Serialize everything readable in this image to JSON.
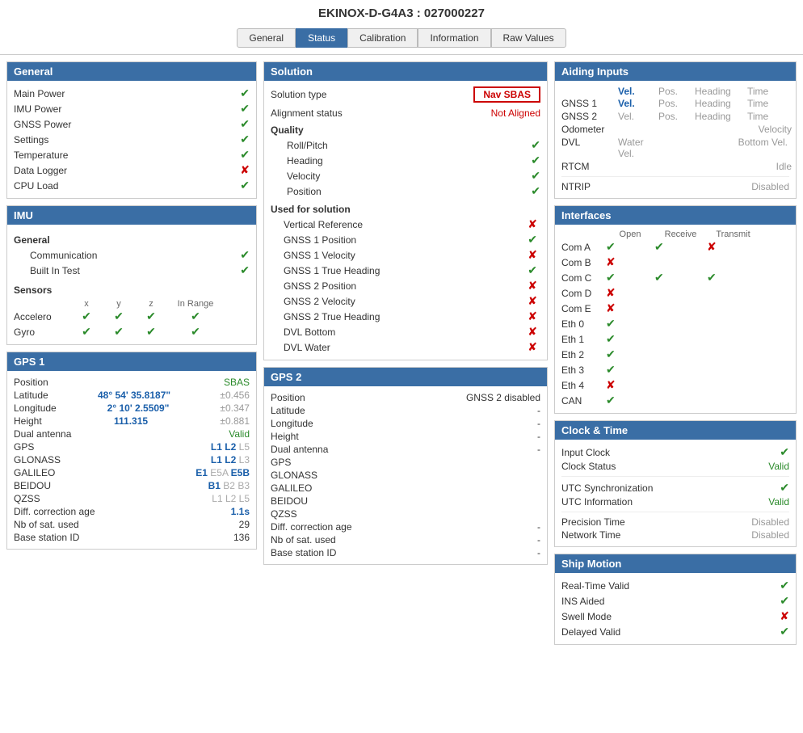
{
  "title": "EKINOX-D-G4A3 : 027000227",
  "tabs": [
    "General",
    "Status",
    "Calibration",
    "Information",
    "Raw Values"
  ],
  "active_tab": "Status",
  "general_panel": {
    "header": "General",
    "rows": [
      {
        "label": "Main Power",
        "status": "check"
      },
      {
        "label": "IMU Power",
        "status": "check"
      },
      {
        "label": "GNSS Power",
        "status": "check"
      },
      {
        "label": "Settings",
        "status": "check"
      },
      {
        "label": "Temperature",
        "status": "check"
      },
      {
        "label": "Data Logger",
        "status": "cross"
      },
      {
        "label": "CPU Load",
        "status": "check"
      }
    ]
  },
  "imu_panel": {
    "header": "IMU",
    "general_label": "General",
    "sub_rows": [
      {
        "label": "Communication",
        "status": "check"
      },
      {
        "label": "Built In Test",
        "status": "check"
      }
    ],
    "sensors_label": "Sensors",
    "sensor_headers": [
      "",
      "x",
      "y",
      "z",
      "In Range"
    ],
    "sensor_rows": [
      {
        "label": "Accelero",
        "x": "check",
        "y": "check",
        "z": "check",
        "range": "check"
      },
      {
        "label": "Gyro",
        "x": "check",
        "y": "check",
        "z": "check",
        "range": "check"
      }
    ]
  },
  "gps1_panel": {
    "header": "GPS 1",
    "position_label": "Position",
    "position_value": "SBAS",
    "latitude_label": "Latitude",
    "latitude_value": "48° 54' 35.8187\"",
    "latitude_err": "±0.456",
    "longitude_label": "Longitude",
    "longitude_value": "2° 10' 2.5509\"",
    "longitude_err": "±0.347",
    "height_label": "Height",
    "height_value": "111.315",
    "height_err": "±0.881",
    "dual_label": "Dual antenna",
    "dual_value": "Valid",
    "gps_label": "GPS",
    "gps_value": "L1 L2 L5",
    "glonass_label": "GLONASS",
    "glonass_value": "L1 L2 L3",
    "galileo_label": "GALILEO",
    "galileo_value": "E1 E5A E5B",
    "beidou_label": "BEIDOU",
    "beidou_value": "B1 B2 B3",
    "qzss_label": "QZSS",
    "qzss_value": "L1 L2 L5",
    "diff_label": "Diff. correction age",
    "diff_value": "1.1s",
    "nb_label": "Nb of sat. used",
    "nb_value": "29",
    "base_label": "Base station ID",
    "base_value": "136"
  },
  "solution_panel": {
    "header": "Solution",
    "sol_type_label": "Solution type",
    "sol_type_value": "Nav SBAS",
    "align_label": "Alignment status",
    "align_value": "Not Aligned",
    "quality_label": "Quality",
    "quality_rows": [
      {
        "label": "Roll/Pitch",
        "status": "check"
      },
      {
        "label": "Heading",
        "status": "check"
      },
      {
        "label": "Velocity",
        "status": "check"
      },
      {
        "label": "Position",
        "status": "check"
      }
    ],
    "used_label": "Used for solution",
    "used_rows": [
      {
        "label": "Vertical Reference",
        "status": "cross"
      },
      {
        "label": "GNSS 1 Position",
        "status": "check"
      },
      {
        "label": "GNSS 1 Velocity",
        "status": "cross"
      },
      {
        "label": "GNSS 1 True Heading",
        "status": "check"
      },
      {
        "label": "GNSS 2 Position",
        "status": "cross"
      },
      {
        "label": "GNSS 2 Velocity",
        "status": "cross"
      },
      {
        "label": "GNSS 2 True Heading",
        "status": "cross"
      },
      {
        "label": "DVL Bottom",
        "status": "cross"
      },
      {
        "label": "DVL Water",
        "status": "cross"
      }
    ]
  },
  "gps2_panel": {
    "header": "GPS 2",
    "position_label": "Position",
    "position_value": "GNSS 2 disabled",
    "latitude_label": "Latitude",
    "latitude_value": "-",
    "longitude_label": "Longitude",
    "longitude_value": "-",
    "height_label": "Height",
    "height_value": "-",
    "dual_label": "Dual antenna",
    "dual_value": "-",
    "gps_label": "GPS",
    "glonass_label": "GLONASS",
    "galileo_label": "GALILEO",
    "beidou_label": "BEIDOU",
    "qzss_label": "QZSS",
    "diff_label": "Diff. correction age",
    "diff_value": "-",
    "nb_label": "Nb of sat. used",
    "nb_value": "-",
    "base_label": "Base station ID",
    "base_value": "-"
  },
  "aiding_panel": {
    "header": "Aiding Inputs",
    "rows": [
      {
        "label": "GNSS 1",
        "vel": "Vel.",
        "pos": "Pos.",
        "heading": "Heading",
        "time": "Time",
        "vel_active": true,
        "pos_active": false,
        "heading_active": false,
        "time_active": false
      },
      {
        "label": "GNSS 2",
        "vel": "Vel.",
        "pos": "Pos.",
        "heading": "Heading",
        "time": "Time",
        "vel_active": false,
        "pos_active": false,
        "heading_active": false,
        "time_active": false
      },
      {
        "label": "Odometer",
        "vel": "",
        "pos": "",
        "heading": "",
        "time": "Velocity",
        "vel_active": false,
        "pos_active": false,
        "heading_active": false,
        "time_active": false
      },
      {
        "label": "DVL",
        "vel": "Water Vel.",
        "pos": "",
        "heading": "",
        "time": "Bottom Vel.",
        "vel_active": false,
        "pos_active": false,
        "heading_active": false,
        "time_active": false
      },
      {
        "label": "RTCM",
        "vel": "",
        "pos": "",
        "heading": "",
        "time": "Idle",
        "vel_active": false,
        "pos_active": false,
        "heading_active": false,
        "time_active": false
      }
    ],
    "ntrip_label": "NTRIP",
    "ntrip_value": "Disabled"
  },
  "interfaces_panel": {
    "header": "Interfaces",
    "col_headers": [
      "",
      "Open",
      "Receive",
      "Transmit"
    ],
    "rows": [
      {
        "label": "Com A",
        "open": "check",
        "receive": "check",
        "transmit": "cross"
      },
      {
        "label": "Com B",
        "open": "cross",
        "receive": "",
        "transmit": ""
      },
      {
        "label": "Com C",
        "open": "check",
        "receive": "check",
        "transmit": "check"
      },
      {
        "label": "Com D",
        "open": "cross",
        "receive": "",
        "transmit": ""
      },
      {
        "label": "Com E",
        "open": "cross",
        "receive": "",
        "transmit": ""
      },
      {
        "label": "Eth 0",
        "open": "check",
        "receive": "",
        "transmit": ""
      },
      {
        "label": "Eth 1",
        "open": "check",
        "receive": "",
        "transmit": ""
      },
      {
        "label": "Eth 2",
        "open": "check",
        "receive": "",
        "transmit": ""
      },
      {
        "label": "Eth 3",
        "open": "check",
        "receive": "",
        "transmit": ""
      },
      {
        "label": "Eth 4",
        "open": "cross",
        "receive": "",
        "transmit": ""
      },
      {
        "label": "CAN",
        "open": "check",
        "receive": "",
        "transmit": ""
      }
    ]
  },
  "clock_panel": {
    "header": "Clock & Time",
    "rows": [
      {
        "label": "Input Clock",
        "value": "check",
        "type": "check"
      },
      {
        "label": "Clock Status",
        "value": "Valid",
        "type": "green"
      },
      {
        "label": "UTC Synchronization",
        "value": "check",
        "type": "check"
      },
      {
        "label": "UTC Information",
        "value": "Valid",
        "type": "green"
      },
      {
        "label": "Precision Time",
        "value": "Disabled",
        "type": "gray"
      },
      {
        "label": "Network Time",
        "value": "Disabled",
        "type": "gray"
      }
    ]
  },
  "ship_panel": {
    "header": "Ship Motion",
    "rows": [
      {
        "label": "Real-Time Valid",
        "status": "check"
      },
      {
        "label": "INS Aided",
        "status": "check"
      },
      {
        "label": "Swell Mode",
        "status": "cross"
      },
      {
        "label": "Delayed Valid",
        "status": "check"
      }
    ]
  }
}
